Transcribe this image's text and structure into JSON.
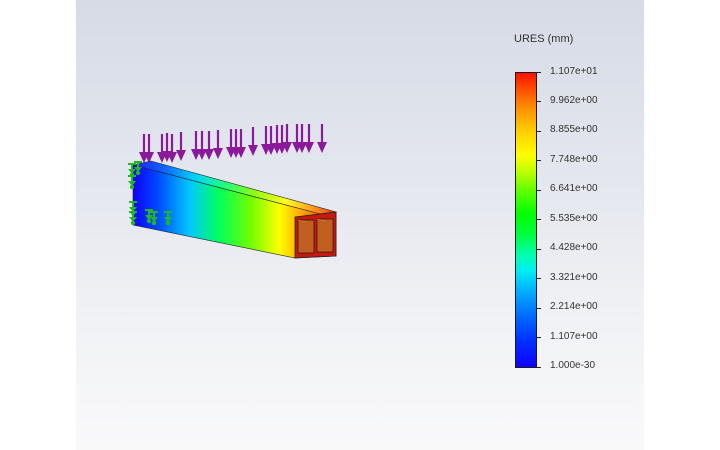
{
  "legend": {
    "title": "URES (mm)",
    "labels": [
      "1.107e+01",
      "9.962e+00",
      "8.855e+00",
      "7.748e+00",
      "6.641e+00",
      "5.535e+00",
      "4.428e+00",
      "3.321e+00",
      "2.214e+00",
      "1.107e+00",
      "1.000e-30"
    ]
  },
  "colors": {
    "load_arrow": "#8a1a9a",
    "fixture": "#1fb81f",
    "beam_min": "#1000ff",
    "beam_max": "#ff1000"
  },
  "icons": {
    "load": "downward-force-arrow",
    "fixture": "fixed-geometry-marker"
  }
}
